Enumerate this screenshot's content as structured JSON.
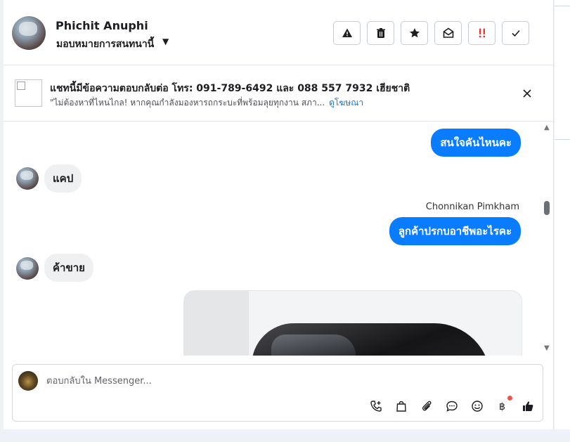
{
  "header": {
    "contact_name": "Phichit Anuphi",
    "assign_label": "มอบหมายการสนทนานี้",
    "actions": [
      "report-icon",
      "trash-icon",
      "star-icon",
      "mark-unread-icon",
      "follow-up-icon",
      "done-icon"
    ]
  },
  "ad_banner": {
    "title": "แชทนี้มีข้อความตอบกลับต่อ โทร: 091-789-6492 และ 088 557 7932 เฮียชาติ",
    "subtitle": "\"ไม่ต้องหาที่ไหนไกล! หากคุณกำลังมองหารถกระบะที่พร้อมลุยทุกงาน สภา...",
    "link": "ดูโฆษณา"
  },
  "messages": [
    {
      "direction": "out",
      "text": "สนใจคันไหนคะ"
    },
    {
      "direction": "in",
      "text": "แคป"
    },
    {
      "direction": "out",
      "sender": "Chonnikan Pimkham",
      "text": "ลูกค้าปรกบอาชีพอะไรคะ"
    },
    {
      "direction": "in",
      "text": "ค้าขาย"
    },
    {
      "direction": "out",
      "type": "photo"
    }
  ],
  "composer": {
    "placeholder": "ตอบกลับใน Messenger...",
    "tools": [
      "call-icon",
      "shopping-bag-icon",
      "attachment-icon",
      "saved-reply-icon",
      "emoji-icon",
      "payment-icon",
      "like-icon"
    ]
  },
  "colors": {
    "accent": "#0a7cff",
    "incoming_bubble": "#eef0f2",
    "link": "#1a73c9",
    "follow_up": "#e53935"
  }
}
